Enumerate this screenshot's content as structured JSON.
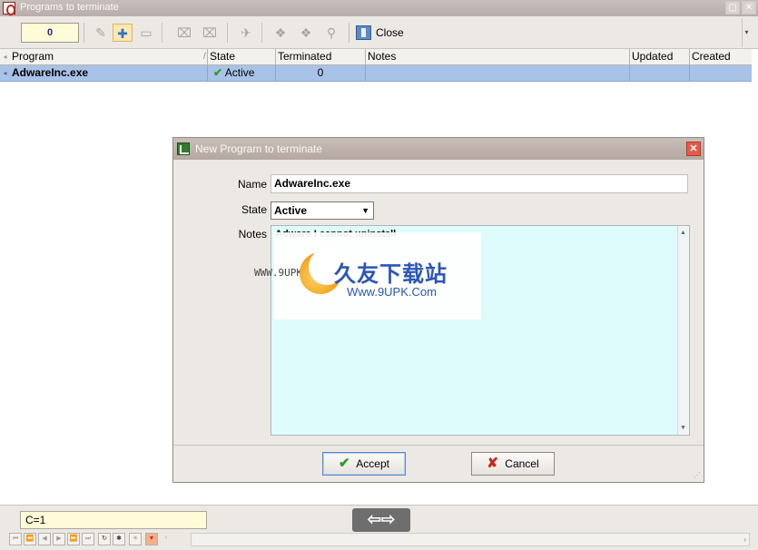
{
  "window": {
    "title": "Programs to terminate"
  },
  "toolbar": {
    "counter": "0",
    "close_label": "Close"
  },
  "grid": {
    "columns": [
      "Program",
      "State",
      "Terminated",
      "Notes",
      "Updated",
      "Created"
    ],
    "rows": [
      {
        "program": "AdwareInc.exe",
        "state": "Active",
        "terminated": "0",
        "notes": "",
        "updated": "",
        "created": ""
      }
    ]
  },
  "dialog": {
    "title": "New Program to terminate",
    "name_label": "Name",
    "name_value": "AdwareInc.exe",
    "state_label": "State",
    "state_value": "Active",
    "notes_label": "Notes",
    "notes_value": "Adware I cannot uninstall",
    "accept_label": "Accept",
    "cancel_label": "Cancel"
  },
  "watermark": {
    "left_text": "WWW.9UPK.COM",
    "chinese_text": "久友下载站",
    "url_text": "Www.9UPK.Com"
  },
  "status": {
    "record_count": "C=1"
  },
  "colors": {
    "selection": "#a9c2e8",
    "notes_bg": "#dffcfc",
    "counter_bg": "#fffbd8"
  }
}
